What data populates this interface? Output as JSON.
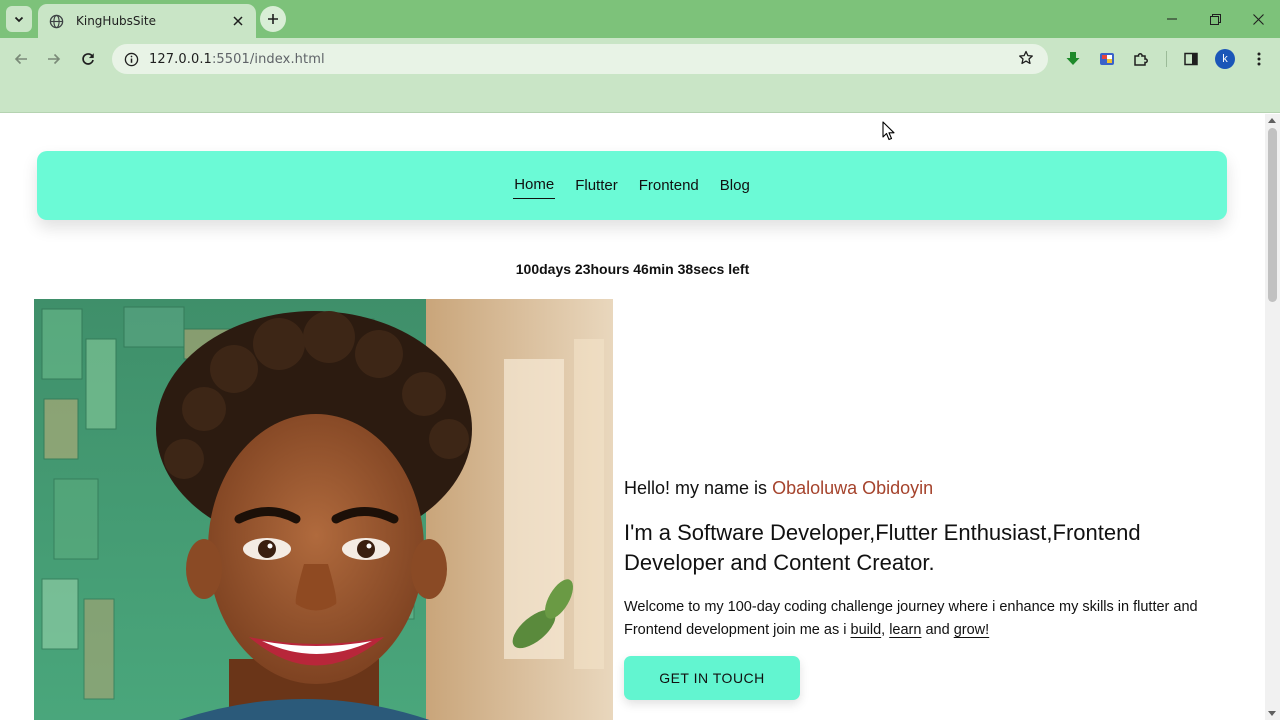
{
  "browser": {
    "tab_title": "KingHubsSite",
    "url_host": "127.0.0.1",
    "url_rest": ":5501/index.html",
    "profile_initial": "k"
  },
  "nav": {
    "links": [
      "Home",
      "Flutter",
      "Frontend",
      "Blog"
    ],
    "active": "Home"
  },
  "countdown": "100days 23hours 46min 38secs left",
  "hero": {
    "greeting_prefix": "Hello! my name is",
    "name": "Obaloluwa Obidoyin",
    "role": "I'm a Software Developer,Flutter Enthusiast,Frontend Developer and Content Creator.",
    "intro_prefix": "Welcome to my 100-day coding challenge journey where i enhance my skills in flutter and Frontend development join me as i",
    "intro_build": "build",
    "intro_learn": "learn",
    "intro_and": "and",
    "intro_grow": "grow!",
    "cta_label": "GET IN TOUCH"
  },
  "colors": {
    "chrome_dark": "#7dc27a",
    "chrome_light": "#c9e5c6",
    "navbar": "#6bfad6",
    "cta": "#62f5d0",
    "name_accent": "#a5432c"
  },
  "icons": {
    "tab_search": "chevron-down-icon",
    "favicon": "globe-icon",
    "back": "arrow-left-icon",
    "forward": "arrow-right-icon",
    "reload": "reload-icon",
    "site_info": "info-icon",
    "bookmark": "star-icon",
    "download": "download-icon",
    "extensions": "puzzle-icon",
    "side_panel": "side-panel-icon",
    "menu": "kebab-menu-icon"
  }
}
